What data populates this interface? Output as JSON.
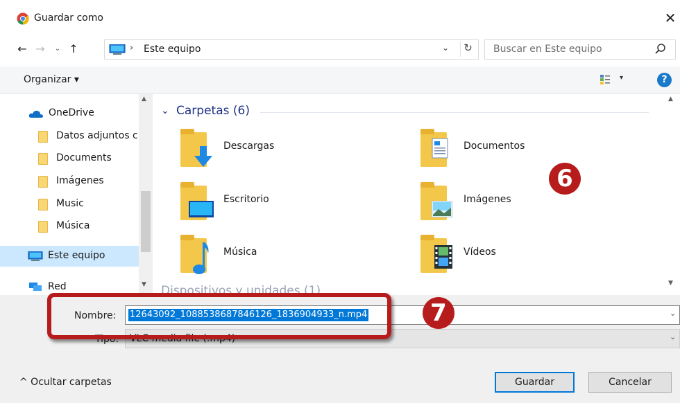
{
  "window": {
    "title": "Guardar como",
    "close": "✕"
  },
  "nav": {
    "back": "←",
    "forward": "→",
    "recent": "⌄",
    "up": "↑",
    "address": {
      "separator": "›",
      "location": "Este equipo",
      "dropdown": "⌄",
      "refresh": "↻"
    },
    "search": {
      "placeholder": "Buscar en Este equipo"
    }
  },
  "toolbar": {
    "organize": "Organizar ▾",
    "view_dropdown": "▾",
    "help": "?"
  },
  "sidebar": {
    "items": [
      {
        "label": "OneDrive",
        "icon": "cloud-icon"
      },
      {
        "label": "Datos adjuntos c",
        "icon": "folder-icon"
      },
      {
        "label": "Documents",
        "icon": "folder-icon"
      },
      {
        "label": "Imágenes",
        "icon": "folder-icon"
      },
      {
        "label": "Music",
        "icon": "folder-icon"
      },
      {
        "label": "Música",
        "icon": "folder-icon"
      },
      {
        "label": "Este equipo",
        "icon": "computer-icon",
        "selected": true
      },
      {
        "label": "Red",
        "icon": "network-icon"
      }
    ]
  },
  "content": {
    "group_title": "Carpetas (6)",
    "group_chevron": "⌄",
    "folders": [
      {
        "name": "Descargas",
        "icon": "downloads-folder-icon"
      },
      {
        "name": "Documentos",
        "icon": "documents-folder-icon"
      },
      {
        "name": "Escritorio",
        "icon": "desktop-folder-icon"
      },
      {
        "name": "Imágenes",
        "icon": "pictures-folder-icon"
      },
      {
        "name": "Música",
        "icon": "music-folder-icon"
      },
      {
        "name": "Vídeos",
        "icon": "videos-folder-icon"
      }
    ],
    "partial_group": "Dispositivos y unidades (1)"
  },
  "form": {
    "name_label": "Nombre:",
    "name_value": "12643092_1088538687846126_1836904933_n.mp4",
    "type_label": "Tipo:",
    "type_value": "VLC media file (.mp4)",
    "dropdown": "⌄"
  },
  "footer": {
    "hide_folders": "^  Ocultar carpetas",
    "save": "Guardar",
    "cancel": "Cancelar"
  },
  "annotations": {
    "step6": "6",
    "step7": "7"
  },
  "colors": {
    "accent": "#0078d7",
    "annotation": "#b71c1c",
    "link": "#1e3287",
    "selection": "#cce8ff"
  }
}
